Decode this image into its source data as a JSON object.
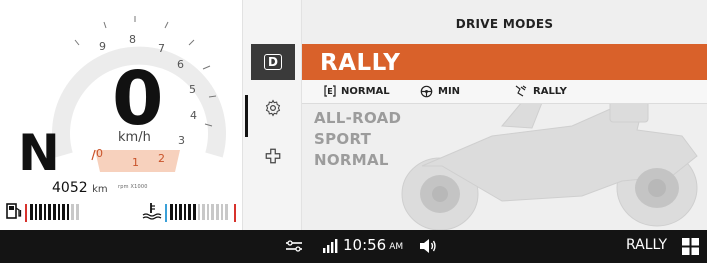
{
  "cluster": {
    "speed": "0",
    "speed_unit": "km/h",
    "gear": "N",
    "odometer_value": "4052",
    "odometer_unit": "km",
    "rpm_label": "rpm X1000",
    "rpm_scale": [
      "9",
      "8",
      "7",
      "6",
      "5",
      "4",
      "3",
      "2",
      "1",
      "0"
    ],
    "fuel_level_fraction": 0.8,
    "temp_level_fraction": 0.45
  },
  "rail": {
    "tabs": [
      {
        "icon": "drive-mode-icon",
        "label": "D"
      },
      {
        "icon": "gear-icon"
      },
      {
        "icon": "puzzle-icon"
      }
    ]
  },
  "drive_modes": {
    "title": "DRIVE MODES",
    "selected": "RALLY",
    "status": {
      "engine_label": "NORMAL",
      "steering_label": "MIN",
      "stability_label": "RALLY"
    },
    "options": [
      "ALL-ROAD",
      "SPORT",
      "NORMAL"
    ]
  },
  "statusbar": {
    "time": "10:56",
    "ampm": "AM",
    "mode": "RALLY"
  },
  "colors": {
    "accent": "#d9612a",
    "redline": "#d7322c",
    "statusbar_bg": "#141414"
  }
}
